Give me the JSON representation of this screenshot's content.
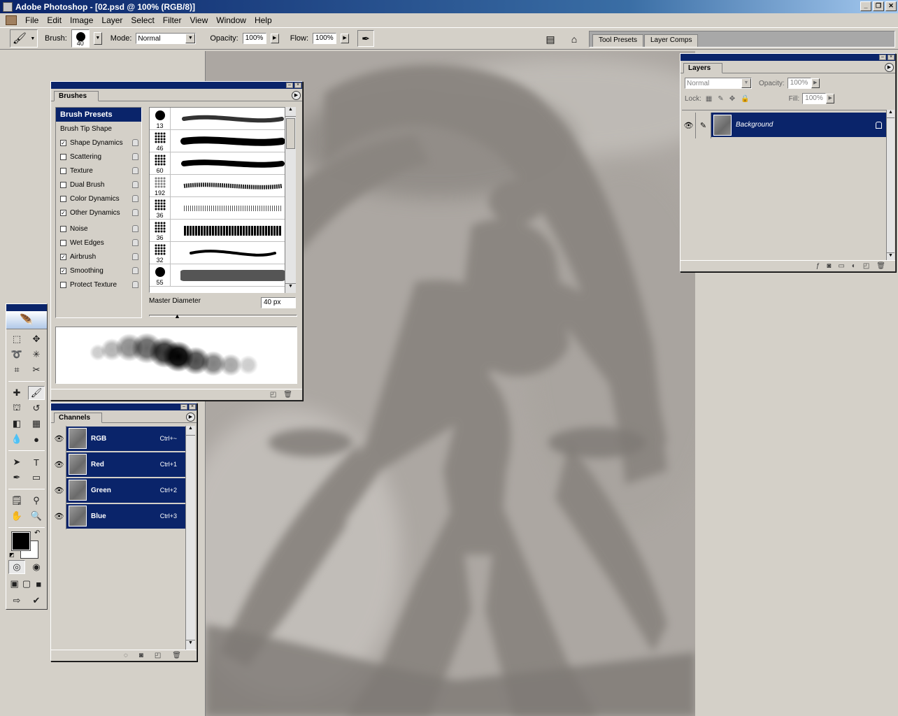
{
  "window": {
    "title": "Adobe Photoshop - [02.psd @ 100% (RGB/8)]"
  },
  "menu": [
    "File",
    "Edit",
    "Image",
    "Layer",
    "Select",
    "Filter",
    "View",
    "Window",
    "Help"
  ],
  "options_bar": {
    "brush_label": "Brush:",
    "brush_size": "40",
    "mode_label": "Mode:",
    "mode_value": "Normal",
    "opacity_label": "Opacity:",
    "opacity_value": "100%",
    "flow_label": "Flow:",
    "flow_value": "100%"
  },
  "palette_well": {
    "tabs": [
      "Tool Presets",
      "Layer Comps"
    ]
  },
  "brushes_panel": {
    "tab": "Brushes",
    "presets_header": "Brush Presets",
    "options": [
      {
        "label": "Brush Tip Shape",
        "checkbox": false,
        "checked": false
      },
      {
        "label": "Shape Dynamics",
        "checkbox": true,
        "checked": true
      },
      {
        "label": "Scattering",
        "checkbox": true,
        "checked": false
      },
      {
        "label": "Texture",
        "checkbox": true,
        "checked": false
      },
      {
        "label": "Dual Brush",
        "checkbox": true,
        "checked": false
      },
      {
        "label": "Color Dynamics",
        "checkbox": true,
        "checked": false
      },
      {
        "label": "Other Dynamics",
        "checkbox": true,
        "checked": true
      },
      {
        "label": "Noise",
        "checkbox": true,
        "checked": false
      },
      {
        "label": "Wet Edges",
        "checkbox": true,
        "checked": false
      },
      {
        "label": "Airbrush",
        "checkbox": true,
        "checked": true
      },
      {
        "label": "Smoothing",
        "checkbox": true,
        "checked": true
      },
      {
        "label": "Protect Texture",
        "checkbox": true,
        "checked": false
      }
    ],
    "presets": [
      "13",
      "46",
      "60",
      "192",
      "36",
      "36",
      "32",
      "55"
    ],
    "master_diameter_label": "Master Diameter",
    "master_diameter_value": "40 px"
  },
  "channels_panel": {
    "tab": "Channels",
    "channels": [
      {
        "name": "RGB",
        "shortcut": "Ctrl+~"
      },
      {
        "name": "Red",
        "shortcut": "Ctrl+1"
      },
      {
        "name": "Green",
        "shortcut": "Ctrl+2"
      },
      {
        "name": "Blue",
        "shortcut": "Ctrl+3"
      }
    ]
  },
  "layers_panel": {
    "tab": "Layers",
    "blend_mode": "Normal",
    "opacity_label": "Opacity:",
    "opacity_value": "100%",
    "lock_label": "Lock:",
    "fill_label": "Fill:",
    "fill_value": "100%",
    "layers": [
      {
        "name": "Background",
        "locked": true
      }
    ]
  }
}
